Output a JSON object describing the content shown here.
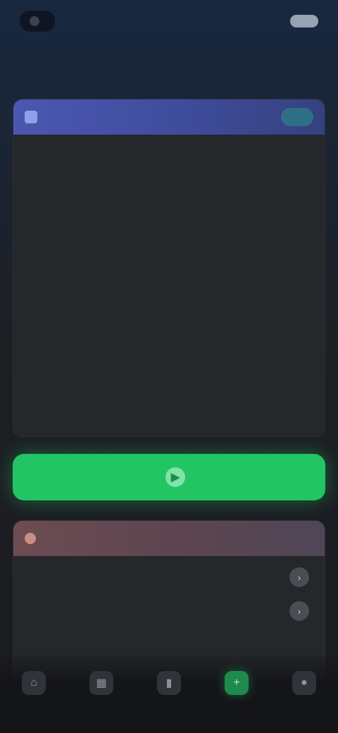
{
  "status_bar": {
    "carrier": "",
    "signal": "",
    "battery_level": 0.8
  },
  "header": {
    "title": ""
  },
  "main_card": {
    "title": "",
    "badge": "",
    "sections": [
      {
        "title": "",
        "body": ""
      },
      {
        "title": "",
        "body": ""
      },
      {
        "title": "",
        "body": ""
      },
      {
        "title": "",
        "body": ""
      },
      {
        "title": "",
        "body": ""
      }
    ]
  },
  "cta": {
    "label": "",
    "icon": "play-icon"
  },
  "tips_card": {
    "title": "",
    "items": [
      {
        "text": "",
        "icon": "chevron-right-icon"
      },
      {
        "text": "",
        "icon": "chevron-right-icon"
      }
    ]
  },
  "tabbar": {
    "active_index": 3,
    "colors": {
      "active": "#22c463",
      "inactive": "#6f7580"
    },
    "tabs": [
      {
        "label": "",
        "icon": "home-icon"
      },
      {
        "label": "",
        "icon": "grid-icon"
      },
      {
        "label": "",
        "icon": "chart-icon"
      },
      {
        "label": "",
        "icon": "plus-icon"
      },
      {
        "label": "",
        "icon": "profile-icon"
      }
    ]
  },
  "colors": {
    "accent_green": "#22c463",
    "card_header_blue": "#4c57b1",
    "card_header_rose": "#6d4c52",
    "background": "#1d1f25"
  }
}
